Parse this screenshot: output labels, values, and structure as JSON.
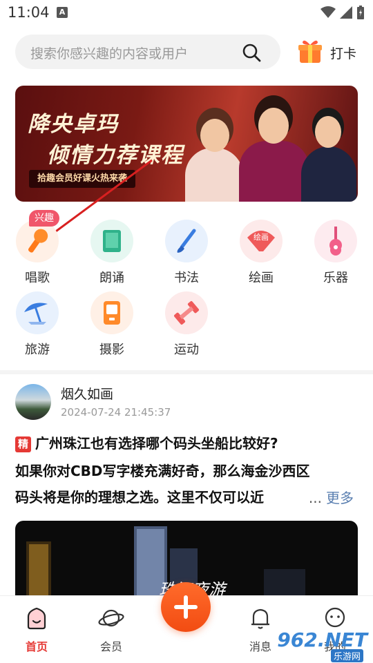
{
  "status": {
    "time": "11:04",
    "a_badge": "A"
  },
  "search": {
    "placeholder": "搜索你感兴趣的内容或用户"
  },
  "checkin": {
    "label": "打卡"
  },
  "banner": {
    "line1": "降央卓玛",
    "line2": "倾情力荐课程",
    "sub": "拾趣会员好课火热来袭"
  },
  "categories": [
    {
      "label": "唱歌",
      "badge": "兴趣"
    },
    {
      "label": "朗诵"
    },
    {
      "label": "书法"
    },
    {
      "label": "绘画",
      "icon_text": "绘画"
    },
    {
      "label": "乐器"
    },
    {
      "label": "旅游"
    },
    {
      "label": "摄影"
    },
    {
      "label": "运动"
    }
  ],
  "post": {
    "user": "烟久如画",
    "time": "2024-07-24 21:45:37",
    "tag": "精",
    "title": "广州珠江也有选择哪个码头坐船比较好?",
    "line2": "如果你对CBD写字楼充满好奇，那么海金沙西区",
    "line3": "码头将是你的理想之选。这里不仅可以近",
    "dots": "...",
    "more": "更多",
    "photo_text": "珠江夜游"
  },
  "tabs": [
    {
      "label": "首页"
    },
    {
      "label": "会员"
    },
    {
      "label": "消息"
    },
    {
      "label": "我的"
    }
  ],
  "watermark": {
    "brand": "962.NET",
    "sub": "乐游网"
  },
  "colors": {
    "accent": "#e53935",
    "fab": "#f24c12",
    "banner": "#7a1a14"
  }
}
